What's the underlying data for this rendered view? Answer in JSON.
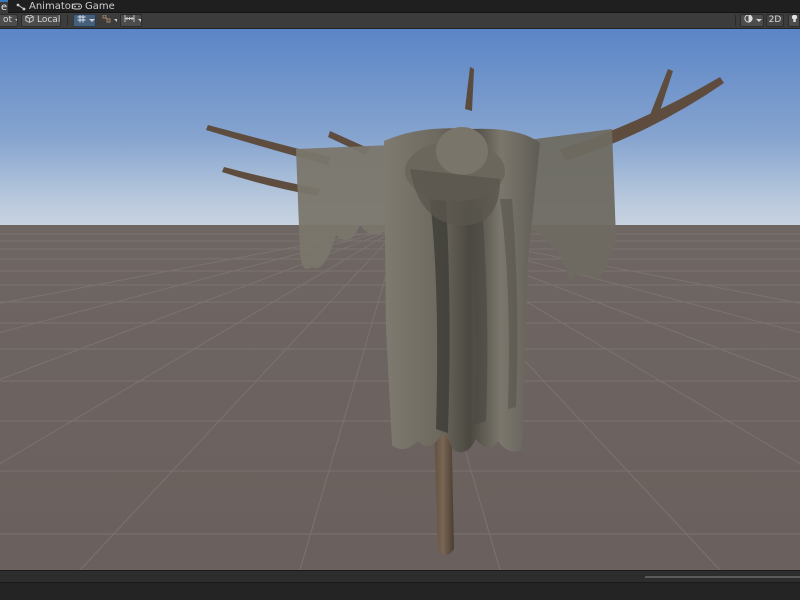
{
  "tabs": [
    {
      "label": "e",
      "icon": "scene-icon",
      "active": true
    },
    {
      "label": "Animator",
      "icon": "animator-icon",
      "active": false
    },
    {
      "label": "Game",
      "icon": "game-controller-icon",
      "active": false
    }
  ],
  "toolbar": {
    "pivot_label": "ot",
    "handle_rotation_label": "Local",
    "shading_mode_icon": "circle-shading-icon",
    "two_d_label": "2D",
    "lighting_icon": "light-bulb-icon",
    "grid_icon": "grid-icon",
    "snap_icon": "snap-icon",
    "increment_snap_icon": "increment-snap-icon"
  },
  "colors": {
    "sky_top": "#5a84c6",
    "sky_horizon": "#c4d2e2",
    "ground": "#6c625f",
    "grid_line": "#7c7470",
    "toolbar_bg": "#3c3c3c",
    "active_tab_accent": "#3a79bb"
  }
}
